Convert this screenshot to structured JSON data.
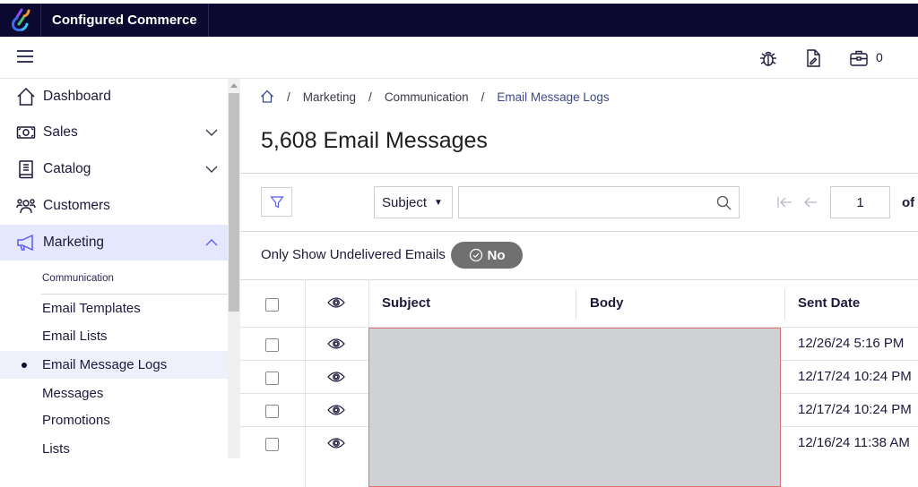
{
  "app": {
    "brand": "Configured Commerce",
    "cart_count": "0"
  },
  "icons": {
    "logo": "optimizely-logo-icon",
    "menu": "hamburger-icon",
    "debug": "bug-icon",
    "edit_doc": "edit-document-icon",
    "cart": "briefcase-icon"
  },
  "sidebar": {
    "items": [
      {
        "label": "Dashboard",
        "icon": "home-icon",
        "expandable": false
      },
      {
        "label": "Sales",
        "icon": "money-icon",
        "expandable": true
      },
      {
        "label": "Catalog",
        "icon": "book-icon",
        "expandable": true
      },
      {
        "label": "Customers",
        "icon": "people-icon",
        "expandable": false
      },
      {
        "label": "Marketing",
        "icon": "megaphone-icon",
        "expandable": true,
        "expanded": true,
        "active": true
      }
    ],
    "section_label": "Communication",
    "sub_items": [
      {
        "label": "Email Templates"
      },
      {
        "label": "Email Lists"
      },
      {
        "label": "Email Message Logs",
        "active": true
      },
      {
        "label": "Messages"
      },
      {
        "label": "Promotions"
      },
      {
        "label": "Lists"
      }
    ]
  },
  "breadcrumb": {
    "items": [
      "Marketing",
      "Communication",
      "Email Message Logs"
    ],
    "separator": "/"
  },
  "page": {
    "title": "5,608 Email Messages"
  },
  "toolbar": {
    "search_field_selected": "Subject",
    "search_value": "",
    "search_placeholder": "",
    "page_number": "1",
    "page_of_label": "of"
  },
  "filter_toggle": {
    "label": "Only Show Undelivered Emails",
    "value": "No"
  },
  "table": {
    "columns": [
      "Subject",
      "Body",
      "Sent Date"
    ],
    "rows": [
      {
        "subject": "",
        "body": "",
        "sent_date": "12/26/24 5:16 PM"
      },
      {
        "subject": "",
        "body": "",
        "sent_date": "12/17/24 10:24 PM"
      },
      {
        "subject": "",
        "body": "",
        "sent_date": "12/17/24 10:24 PM"
      },
      {
        "subject": "",
        "body": "",
        "sent_date": "12/16/24 11:38 AM"
      }
    ]
  },
  "colors": {
    "topbar_bg": "#0c0930",
    "active_nav_bg": "#e5e7fd",
    "active_sub_bg": "#eef0fc",
    "accent": "#5b5bf5",
    "toggle_bg": "#707070",
    "redaction": "#d0d1d4"
  }
}
